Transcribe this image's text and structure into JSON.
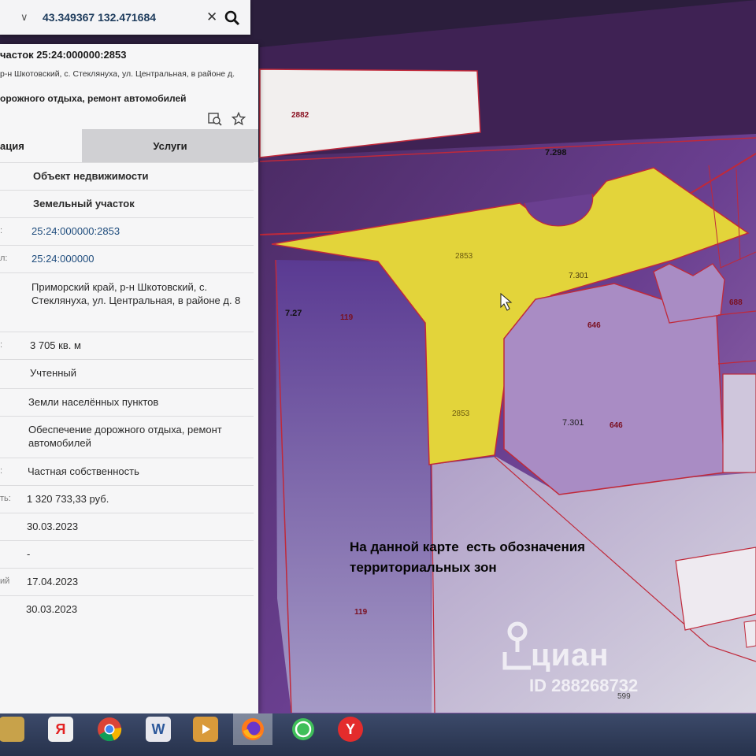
{
  "search": {
    "query": "43.349367 132.471684"
  },
  "panel": {
    "title": "часток 25:24:000000:2853",
    "address": "р-н Шкотовский, с. Стеклянуха, ул. Центральная, в районе д.",
    "purpose": "орожного отдыха, ремонт автомобилей",
    "tabs": [
      {
        "label": "ация"
      },
      {
        "label": "Услуги"
      }
    ],
    "rows": [
      {
        "label": "",
        "value": "Объект недвижимости"
      },
      {
        "label": "",
        "value": "Земельный участок"
      },
      {
        "label": ":",
        "value": "25:24:000000:2853"
      },
      {
        "label": "л:",
        "value": "25:24:000000"
      },
      {
        "label": "",
        "value": "Приморский край, р-н Шкотовский, с. Стеклянуха, ул. Центральная, в районе д. 8"
      },
      {
        "label": ":",
        "value": "3 705 кв. м"
      },
      {
        "label": "",
        "value": "Учтенный"
      },
      {
        "label": "",
        "value": "Земли населённых пунктов"
      },
      {
        "label": "",
        "value": "Обеспечение дорожного отдыха, ремонт автомобилей"
      },
      {
        "label": ":",
        "value": "Частная собственность"
      },
      {
        "label": "ть:",
        "value": "1 320 733,33 руб."
      },
      {
        "label": "",
        "value": "30.03.2023"
      },
      {
        "label": "",
        "value": "-"
      },
      {
        "label": "ий",
        "value": "17.04.2023"
      },
      {
        "label": "",
        "value": "30.03.2023"
      }
    ]
  },
  "map": {
    "labels": {
      "parcel_2882": "2882",
      "zone_7298": "7.298",
      "parcel_2853_top": "2853",
      "zone_7301_top": "7.301",
      "zone_727": "7.27",
      "parcel_119_top": "119",
      "parcel_646_top": "646",
      "parcel_688": "688",
      "parcel_2853_bottom": "2853",
      "zone_7301_mid": "7.301",
      "parcel_646_mid": "646",
      "parcel_119_bottom": "119",
      "parcel_599": "599"
    },
    "colors": {
      "selected_parcel": "#e3d43a",
      "zone_fill": "#6b3f8f",
      "boundary": "#c0293a"
    }
  },
  "annotation": {
    "text": "На данной карте  есть обозначения\nтерриториальных зон"
  },
  "watermark": {
    "brand": "циан",
    "id": "ID 288268732"
  },
  "taskbar": {
    "items": [
      {
        "icon": "library-icon"
      },
      {
        "icon": "yandex-icon",
        "glyph": "Я"
      },
      {
        "icon": "chrome-icon"
      },
      {
        "icon": "word-icon",
        "glyph": "W"
      },
      {
        "icon": "media-player-icon"
      },
      {
        "icon": "firefox-icon"
      },
      {
        "icon": "whatsapp-icon"
      },
      {
        "icon": "yandex-browser-icon",
        "glyph": "Y"
      }
    ]
  }
}
